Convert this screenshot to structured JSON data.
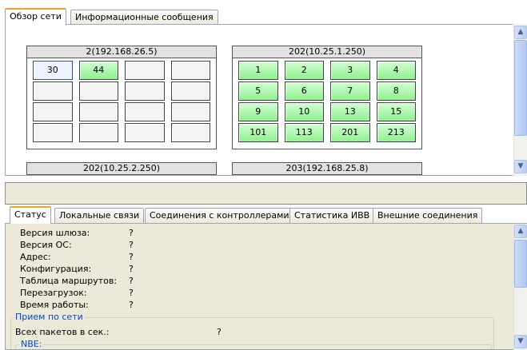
{
  "top_tabs": [
    "Обзор сети",
    "Информационные сообщения"
  ],
  "groups": [
    {
      "title": "2(192.168.26.5)",
      "cells": [
        {
          "text": "30",
          "state": "selected"
        },
        {
          "text": "44",
          "state": "green"
        },
        {
          "text": "",
          "state": "empty"
        },
        {
          "text": "",
          "state": "empty"
        },
        {
          "text": "",
          "state": "empty"
        },
        {
          "text": "",
          "state": "empty"
        },
        {
          "text": "",
          "state": "empty"
        },
        {
          "text": "",
          "state": "empty"
        },
        {
          "text": "",
          "state": "empty"
        },
        {
          "text": "",
          "state": "empty"
        },
        {
          "text": "",
          "state": "empty"
        },
        {
          "text": "",
          "state": "empty"
        },
        {
          "text": "",
          "state": "empty"
        },
        {
          "text": "",
          "state": "empty"
        },
        {
          "text": "",
          "state": "empty"
        },
        {
          "text": "",
          "state": "empty"
        }
      ]
    },
    {
      "title": "202(10.25.1.250)",
      "cells": [
        {
          "text": "1",
          "state": "green"
        },
        {
          "text": "2",
          "state": "green"
        },
        {
          "text": "3",
          "state": "green"
        },
        {
          "text": "4",
          "state": "green"
        },
        {
          "text": "5",
          "state": "green"
        },
        {
          "text": "6",
          "state": "green"
        },
        {
          "text": "7",
          "state": "green"
        },
        {
          "text": "8",
          "state": "green"
        },
        {
          "text": "9",
          "state": "green"
        },
        {
          "text": "10",
          "state": "green"
        },
        {
          "text": "13",
          "state": "green"
        },
        {
          "text": "15",
          "state": "green"
        },
        {
          "text": "101",
          "state": "green"
        },
        {
          "text": "113",
          "state": "green"
        },
        {
          "text": "201",
          "state": "green"
        },
        {
          "text": "213",
          "state": "green"
        }
      ]
    },
    {
      "title": "202(10.25.2.250)",
      "cells": [
        {
          "text": "",
          "state": "green"
        },
        {
          "text": "",
          "state": "green"
        },
        {
          "text": "",
          "state": "green"
        },
        {
          "text": "",
          "state": "green"
        }
      ]
    },
    {
      "title": "203(192.168.25.8)",
      "cells": [
        {
          "text": "",
          "state": "green"
        },
        {
          "text": "",
          "state": "empty"
        },
        {
          "text": "",
          "state": "empty"
        },
        {
          "text": "",
          "state": "empty"
        }
      ]
    }
  ],
  "bottom_tabs": [
    "Статус",
    "Локальные связи",
    "Соединения с контроллерами",
    "Статистика ИВВ",
    "Внешние соединения"
  ],
  "status": {
    "rows": [
      {
        "label": "Версия шлюза:",
        "value": "?"
      },
      {
        "label": "Версия ОС:",
        "value": "?"
      },
      {
        "label": "Адрес:",
        "value": "?"
      },
      {
        "label": "Конфигурация:",
        "value": "?"
      },
      {
        "label": "Таблица маршрутов:",
        "value": "?"
      },
      {
        "label": "Перезагрузок:",
        "value": "?"
      },
      {
        "label": "Время работы:",
        "value": "?"
      }
    ],
    "network_group_title": "Прием по сети",
    "packets_label": "Всех пакетов в сек.:",
    "packets_value": "?",
    "sub_group_title": "NBE:"
  },
  "scroll_icons": [
    "arrow-up-icon",
    "arrow-down-icon"
  ]
}
